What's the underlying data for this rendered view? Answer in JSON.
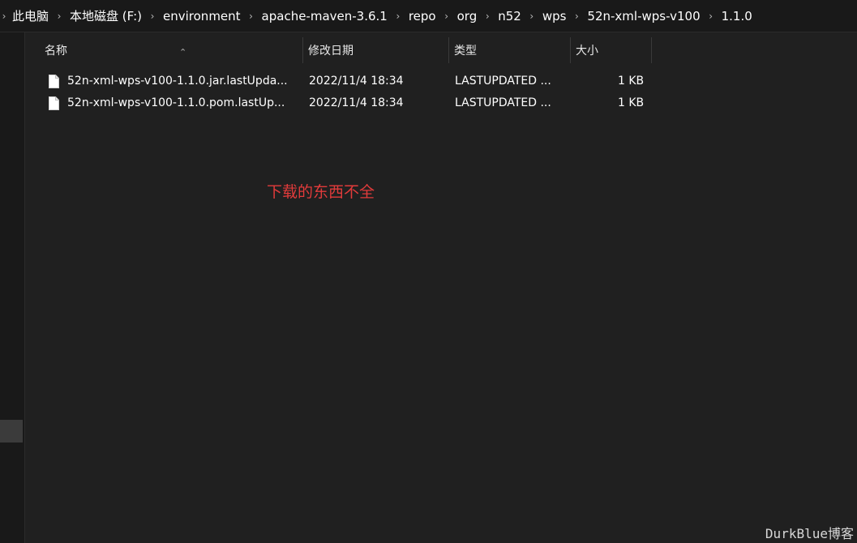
{
  "breadcrumb": {
    "items": [
      "此电脑",
      "本地磁盘 (F:)",
      "environment",
      "apache-maven-3.6.1",
      "repo",
      "org",
      "n52",
      "wps",
      "52n-xml-wps-v100",
      "1.1.0"
    ]
  },
  "columns": {
    "name": "名称",
    "modified": "修改日期",
    "type": "类型",
    "size": "大小"
  },
  "files": [
    {
      "name": "52n-xml-wps-v100-1.1.0.jar.lastUpda...",
      "modified": "2022/11/4 18:34",
      "type": "LASTUPDATED ...",
      "size": "1 KB"
    },
    {
      "name": "52n-xml-wps-v100-1.1.0.pom.lastUp...",
      "modified": "2022/11/4 18:34",
      "type": "LASTUPDATED ...",
      "size": "1 KB"
    }
  ],
  "annotation": "下载的东西不全",
  "watermark": "DurkBlue博客",
  "icons": {
    "breadcrumb_separator": "chevron-right-icon",
    "sort": "sort-ascending-icon",
    "file": "file-icon"
  },
  "colors": {
    "background": "#202020",
    "annotation": "#e23b3b"
  }
}
